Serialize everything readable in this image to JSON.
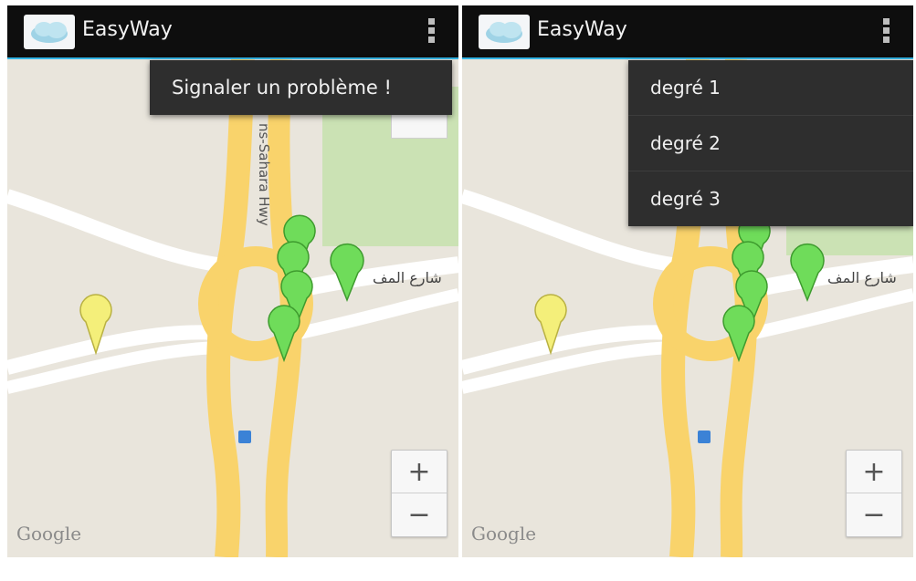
{
  "app": {
    "title": "EasyWay"
  },
  "menu_left": {
    "items": [
      "Signaler un problème !"
    ]
  },
  "menu_right": {
    "items": [
      "degré 1",
      "degré 2",
      "degré 3"
    ]
  },
  "map": {
    "attribution": "Google",
    "highway_label": "ns-Sahara Hwy",
    "street_label": "شارع المف",
    "zoom_in": "+",
    "zoom_out": "−",
    "markers": {
      "green": 5,
      "yellow": 1
    }
  },
  "colors": {
    "actionbar": "#0e0e0e",
    "accent": "#33b5e5",
    "road_major": "#f9d36b",
    "park": "#cbe2b4",
    "marker_green": "#6fdc5a",
    "marker_yellow": "#f4ef7a"
  }
}
